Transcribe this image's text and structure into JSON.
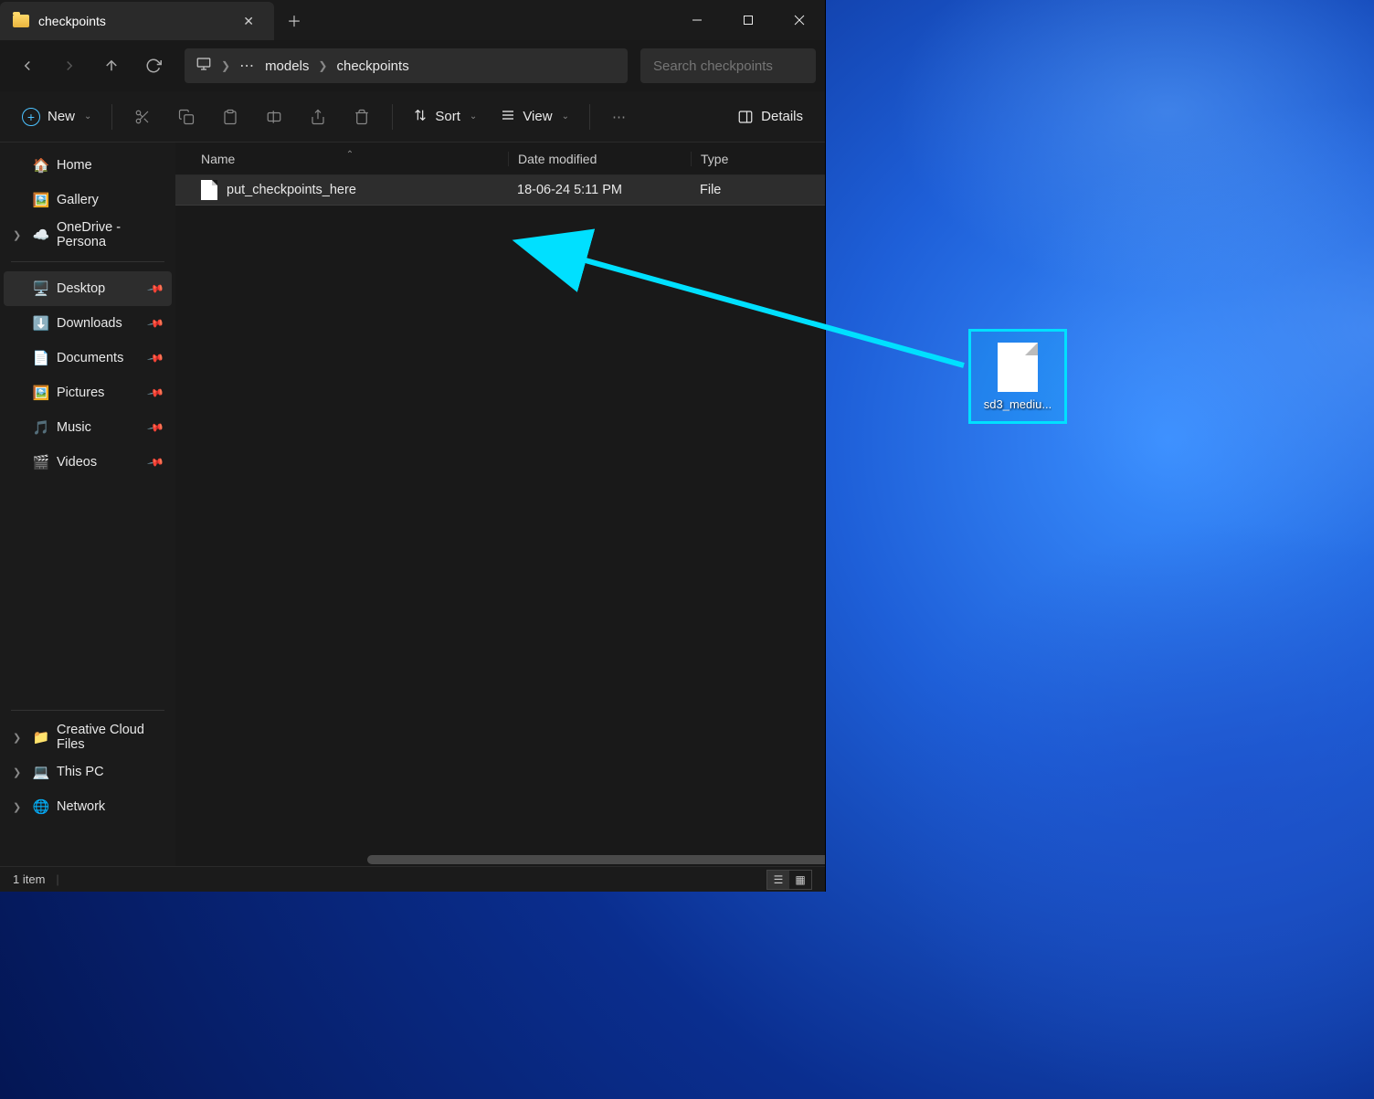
{
  "tab": {
    "title": "checkpoints"
  },
  "breadcrumb": {
    "segments": [
      "models",
      "checkpoints"
    ]
  },
  "search": {
    "placeholder": "Search checkpoints"
  },
  "toolbar": {
    "new_label": "New",
    "sort_label": "Sort",
    "view_label": "View",
    "details_label": "Details"
  },
  "sidebar": {
    "top": [
      {
        "label": "Home",
        "icon": "🏠"
      },
      {
        "label": "Gallery",
        "icon": "🖼️"
      },
      {
        "label": "OneDrive - Persona",
        "icon": "☁️",
        "expandable": true
      }
    ],
    "pinned": [
      {
        "label": "Desktop",
        "icon": "🖥️",
        "selected": true
      },
      {
        "label": "Downloads",
        "icon": "⬇️"
      },
      {
        "label": "Documents",
        "icon": "📄"
      },
      {
        "label": "Pictures",
        "icon": "🖼️"
      },
      {
        "label": "Music",
        "icon": "🎵"
      },
      {
        "label": "Videos",
        "icon": "🎬"
      }
    ],
    "bottom": [
      {
        "label": "Creative Cloud Files",
        "icon": "📁",
        "expandable": true
      },
      {
        "label": "This PC",
        "icon": "💻",
        "expandable": true
      },
      {
        "label": "Network",
        "icon": "🌐",
        "expandable": true
      }
    ]
  },
  "columns": {
    "name": "Name",
    "date": "Date modified",
    "type": "Type"
  },
  "files": [
    {
      "name": "put_checkpoints_here",
      "date": "18-06-24 5:11 PM",
      "type": "File"
    }
  ],
  "status": {
    "count": "1 item"
  },
  "desktop_file": {
    "name": "sd3_mediu..."
  }
}
